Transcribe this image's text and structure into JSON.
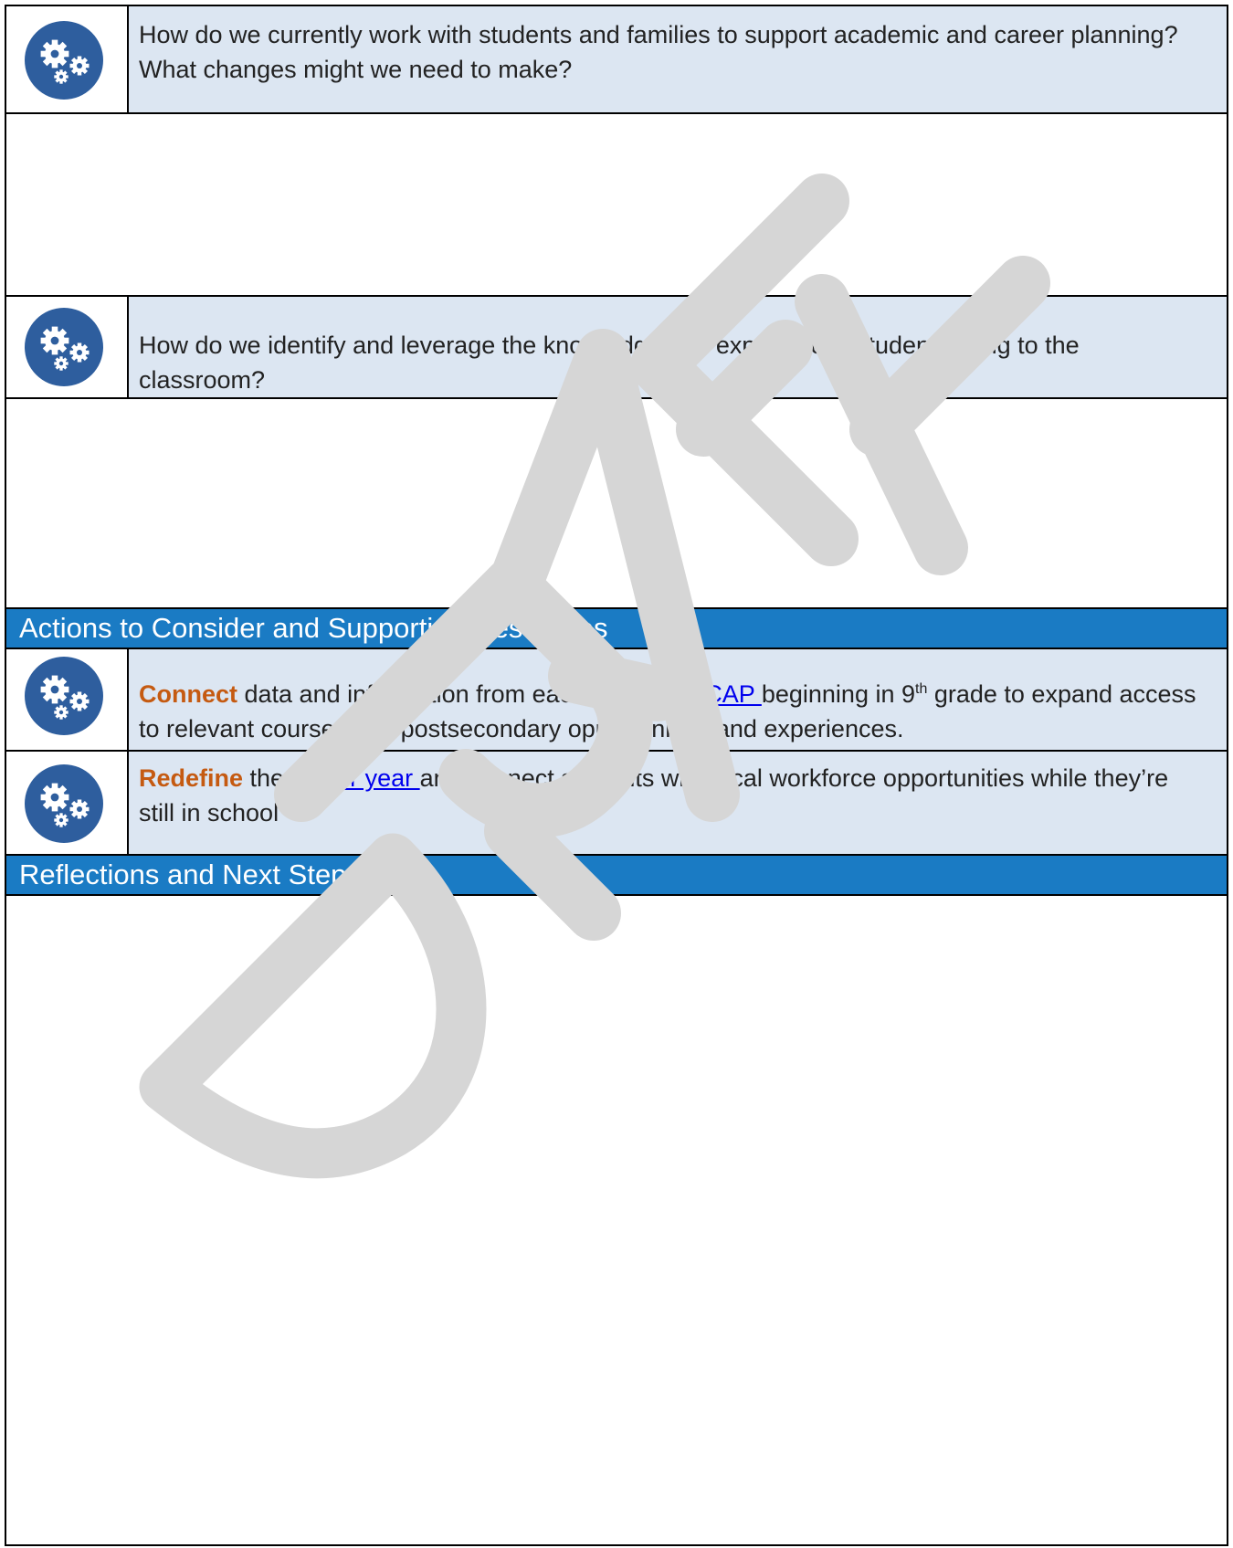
{
  "questions": [
    {
      "icon": "gears-icon",
      "text": "How do we currently work with students and families to support academic and career planning? What changes might we need to make?"
    },
    {
      "icon": "gears-icon",
      "text": "How do we identify and leverage the knowledge and experiences students bring to the classroom?"
    }
  ],
  "actions_header": "Actions to Consider and Supporting Resources",
  "actions": [
    {
      "icon": "gears-icon",
      "keyword": "Connect",
      "pre_link": " data and information from each ",
      "link": "student’s ICAP ",
      "post_link_1": "beginning in 9",
      "sup": "th",
      "post_link_2": " grade to expand access to relevant coursework, postsecondary opportunities and experiences."
    },
    {
      "icon": "gears-icon",
      "keyword": "Redefine",
      "pre_link": " the ",
      "link": "senior year ",
      "post_link_1": "and connect students with local workforce opportunities while they’re still in school"
    }
  ],
  "reflections_header": "Reflections and Next Steps",
  "watermark": "DRAFT",
  "colors": {
    "question_bg": "#dce6f2",
    "header_bg": "#1a7bc4",
    "keyword": "#c55a11",
    "link": "#0000ee",
    "icon": "#2e5e9e"
  }
}
